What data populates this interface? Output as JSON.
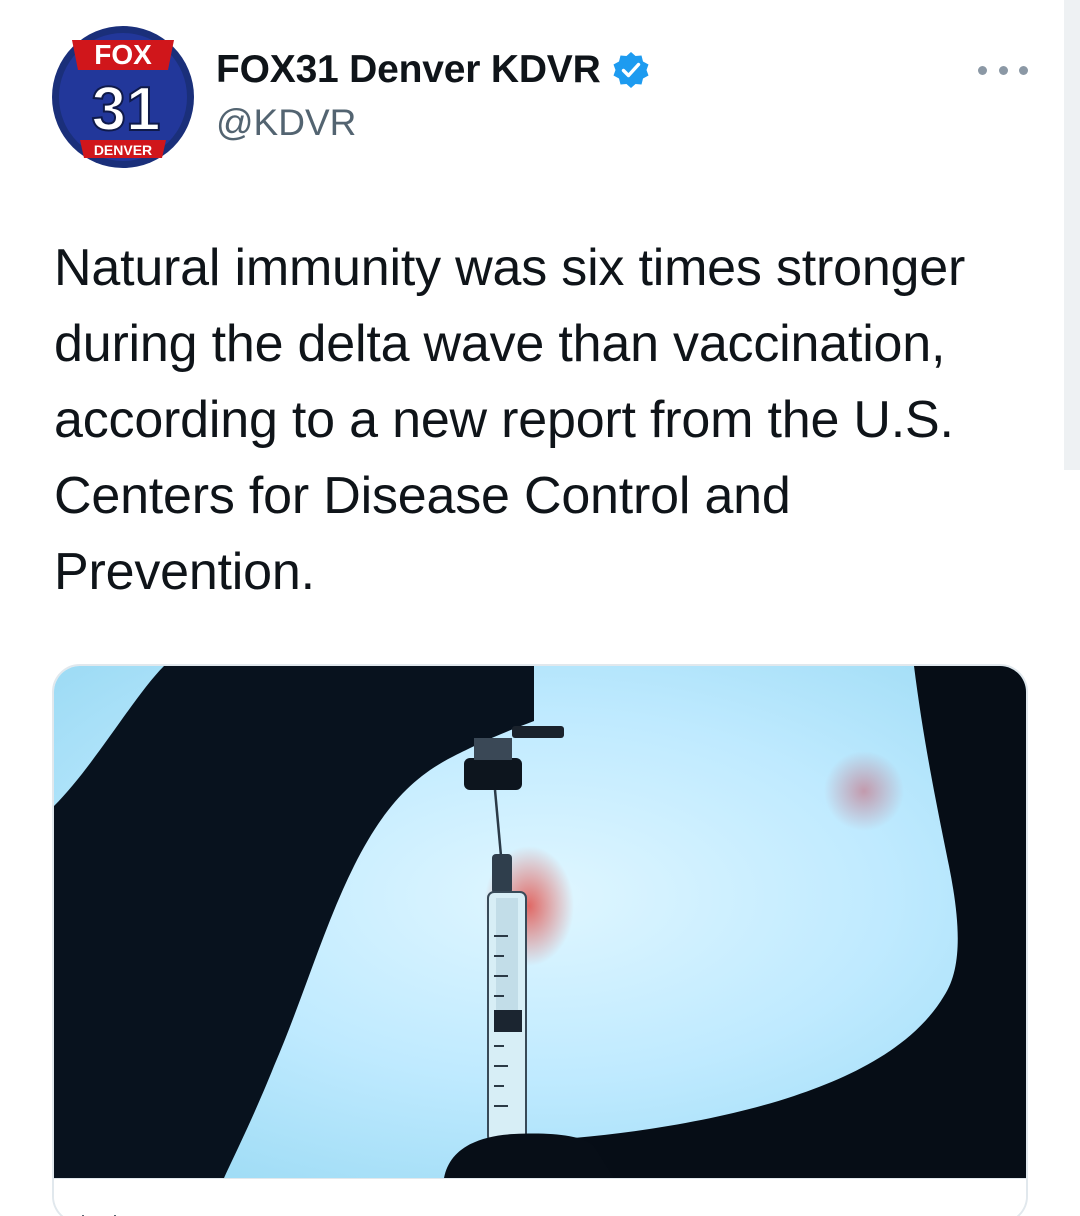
{
  "account": {
    "display_name": "FOX31 Denver KDVR",
    "handle": "@KDVR",
    "verified": true,
    "logo": {
      "top_text": "FOX",
      "number": "31",
      "bottom_text": "DENVER"
    }
  },
  "tweet": {
    "text": "Natural immunity was six times stronger during the delta wave than vaccination, according to a new report from the U.S. Centers for Disease Control and Prevention."
  },
  "media": {
    "type": "photo",
    "subject": "syringe-and-vial-silhouette"
  },
  "colors": {
    "text_primary": "#0f1419",
    "text_secondary": "#536471",
    "verified_blue": "#1d9bf0",
    "fox_red": "#d0161b",
    "fox_navy": "#1a2f7a"
  },
  "icons": {
    "more": "ellipsis-icon",
    "verified": "verified-badge-icon"
  }
}
